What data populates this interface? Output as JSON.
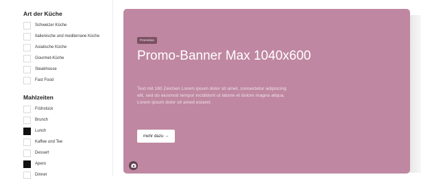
{
  "filters": {
    "cuisine": {
      "title": "Art der Küche",
      "items": [
        {
          "label": "Schweizer Küche",
          "checked": false
        },
        {
          "label": "Italienische und mediterrane Küche",
          "checked": false
        },
        {
          "label": "Asiatische Küche",
          "checked": false
        },
        {
          "label": "Gourmet-Küche",
          "checked": false
        },
        {
          "label": "Steakhouse",
          "checked": false
        },
        {
          "label": "Fast Food",
          "checked": false
        }
      ]
    },
    "meals": {
      "title": "Mahlzeiten",
      "items": [
        {
          "label": "Frühstück",
          "checked": false
        },
        {
          "label": "Brunch",
          "checked": false
        },
        {
          "label": "Lunch",
          "checked": true
        },
        {
          "label": "Kaffee und Tee",
          "checked": false
        },
        {
          "label": "Dessert",
          "checked": false
        },
        {
          "label": "Apero",
          "checked": true
        },
        {
          "label": "Dinner",
          "checked": false
        }
      ]
    }
  },
  "banner": {
    "badge": "Promotion",
    "headline": "Promo-Banner Max 1040x600",
    "text": "Text mit 180 Zeichen Lorem ipsum dolor sit amet, consectetur adipiscing elit, sed do eiusmod tempor incididunt ut labore et dolore magna aliqua. Lorem ipsum dolor sit amed estaret.",
    "cta": "mehr dazu →",
    "background": "#bf87a1",
    "icon": "camera-icon"
  }
}
